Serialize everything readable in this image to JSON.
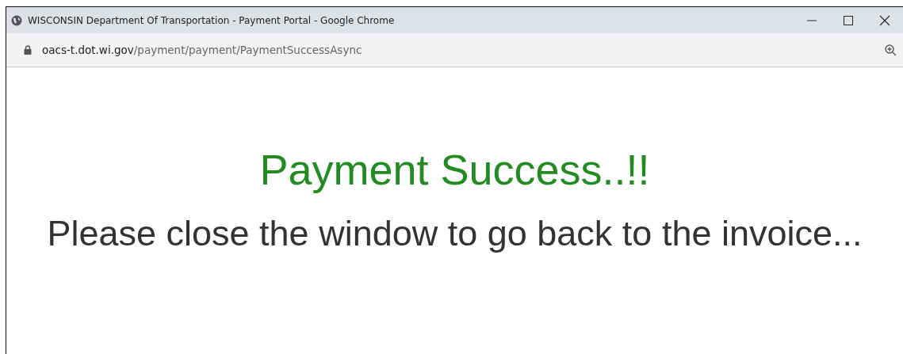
{
  "window": {
    "title": "WISCONSIN Department Of Transportation - Payment Portal - Google Chrome"
  },
  "address_bar": {
    "host": "oacs-t.dot.wi.gov",
    "path": "/payment/payment/PaymentSuccessAsync"
  },
  "page": {
    "heading": "Payment Success..!!",
    "message": "Please close the window to go back to the invoice..."
  }
}
